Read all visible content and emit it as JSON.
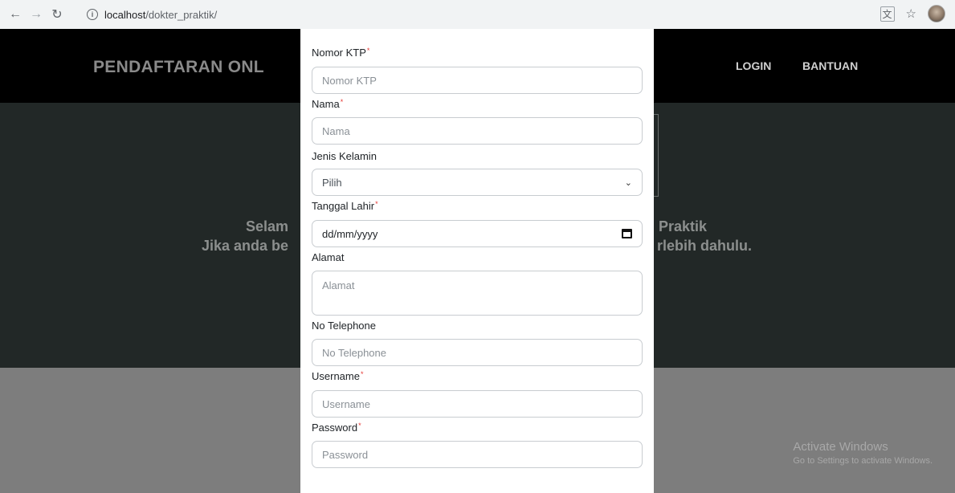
{
  "browser": {
    "url_host": "localhost",
    "url_path": "/dokter_praktik/"
  },
  "navbar": {
    "brand": "PENDAFTARAN ONL",
    "links": [
      "LOGIN",
      "BANTUAN"
    ]
  },
  "hero": {
    "line1_left": "Selam",
    "line1_right": "Praktik",
    "line2_left": "Jika anda be",
    "line2_right": "rlebih dahulu."
  },
  "form": {
    "ktp": {
      "label": "Nomor KTP",
      "placeholder": "Nomor KTP"
    },
    "nama": {
      "label": "Nama",
      "placeholder": "Nama"
    },
    "jenis_kelamin": {
      "label": "Jenis Kelamin",
      "value": "Pilih"
    },
    "tanggal_lahir": {
      "label": "Tanggal Lahir",
      "value": "dd/mm/yyyy"
    },
    "alamat": {
      "label": "Alamat",
      "placeholder": "Alamat"
    },
    "telepon": {
      "label": "No Telephone",
      "placeholder": "No Telephone"
    },
    "username": {
      "label": "Username",
      "placeholder": "Username"
    },
    "password": {
      "label": "Password",
      "placeholder": "Password"
    },
    "required_mark": "*"
  },
  "watermark": {
    "title": "Activate Windows",
    "subtitle": "Go to Settings to activate Windows."
  }
}
